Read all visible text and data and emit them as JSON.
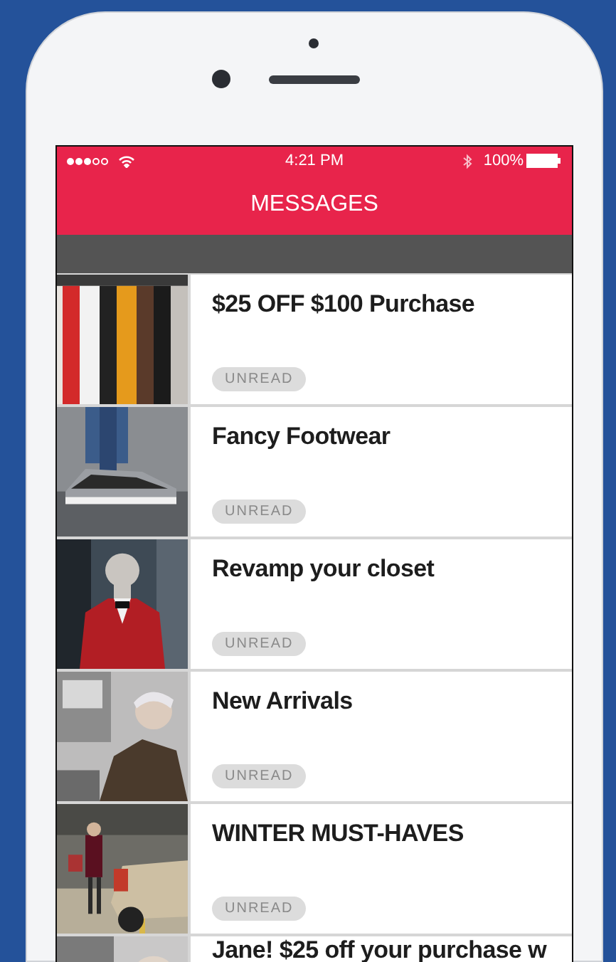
{
  "status_bar": {
    "time": "4:21 PM",
    "battery": "100%"
  },
  "nav": {
    "title": "MESSAGES"
  },
  "messages": [
    {
      "title": "$25 OFF $100 Purchase",
      "badge": "UNREAD"
    },
    {
      "title": "Fancy Footwear",
      "badge": "UNREAD"
    },
    {
      "title": "Revamp your closet",
      "badge": "UNREAD"
    },
    {
      "title": "New Arrivals",
      "badge": "UNREAD"
    },
    {
      "title": "WINTER MUST-HAVES",
      "badge": "UNREAD"
    },
    {
      "title": "Jane! $25 off your purchase w"
    }
  ]
}
